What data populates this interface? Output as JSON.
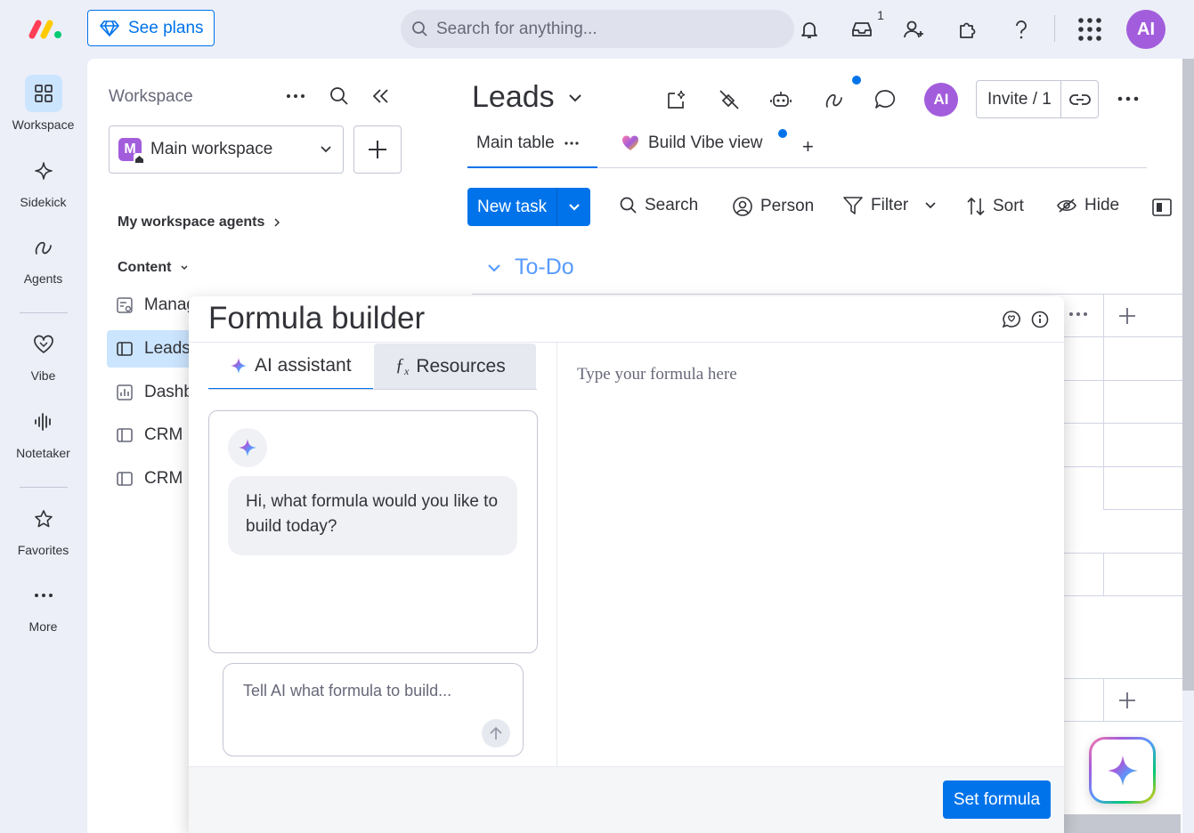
{
  "topbar": {
    "see_plans": "See plans",
    "search_placeholder": "Search for anything...",
    "inbox_count": "1",
    "avatar_initials": "AI"
  },
  "rail": {
    "items": [
      {
        "label": "Workspace"
      },
      {
        "label": "Sidekick"
      },
      {
        "label": "Agents"
      },
      {
        "label": "Vibe"
      },
      {
        "label": "Notetaker"
      },
      {
        "label": "Favorites"
      },
      {
        "label": "More"
      }
    ]
  },
  "workspace": {
    "title": "Workspace",
    "selected": "Main workspace",
    "selected_initial": "M",
    "agents_label": "My workspace agents",
    "content_label": "Content",
    "items": [
      {
        "label": "Manag"
      },
      {
        "label": "Leads"
      },
      {
        "label": "Dashb"
      },
      {
        "label": "CRM"
      },
      {
        "label": "CRM"
      }
    ]
  },
  "board": {
    "title": "Leads",
    "avatar_initials": "AI",
    "invite": "Invite / 1",
    "tabs": [
      {
        "label": "Main table"
      },
      {
        "label": "Build Vibe view"
      }
    ],
    "add_view": "+",
    "new_task": "New task",
    "tools": {
      "search": "Search",
      "person": "Person",
      "filter": "Filter",
      "sort": "Sort",
      "hide": "Hide"
    },
    "group_title": "To-Do"
  },
  "formula_builder": {
    "title": "Formula builder",
    "tabs": {
      "ai_assistant": "AI assistant",
      "resources": "Resources"
    },
    "greeting": "Hi, what formula would you like to build today?",
    "prompt_placeholder": "Tell AI what formula to build...",
    "formula_placeholder": "Type your formula here",
    "set_formula": "Set formula"
  },
  "colors": {
    "primary": "#0073ea",
    "avatar": "#a25ddc",
    "group": "#579bfc"
  }
}
